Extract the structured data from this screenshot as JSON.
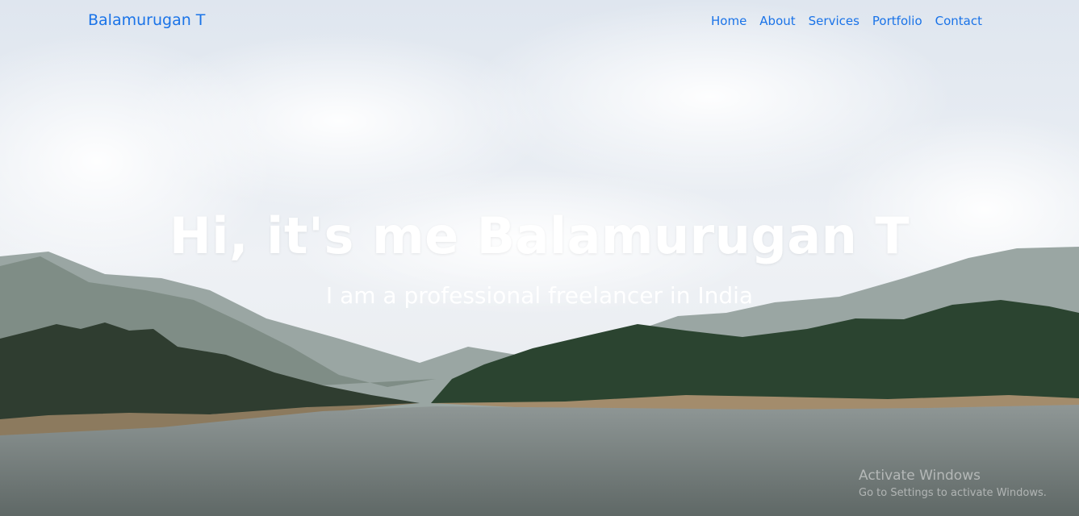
{
  "navbar": {
    "brand": "Balamurugan T",
    "links": [
      "Home",
      "About",
      "Services",
      "Portfolio",
      "Contact"
    ]
  },
  "hero": {
    "headline": "Hi, it's me Balamurugan T",
    "subline": "I am a professional freelancer in India"
  },
  "watermark": {
    "title": "Activate Windows",
    "subtitle": "Go to Settings to activate Windows."
  },
  "colors": {
    "link": "#1a73e8",
    "hero_text": "#ffffff"
  }
}
